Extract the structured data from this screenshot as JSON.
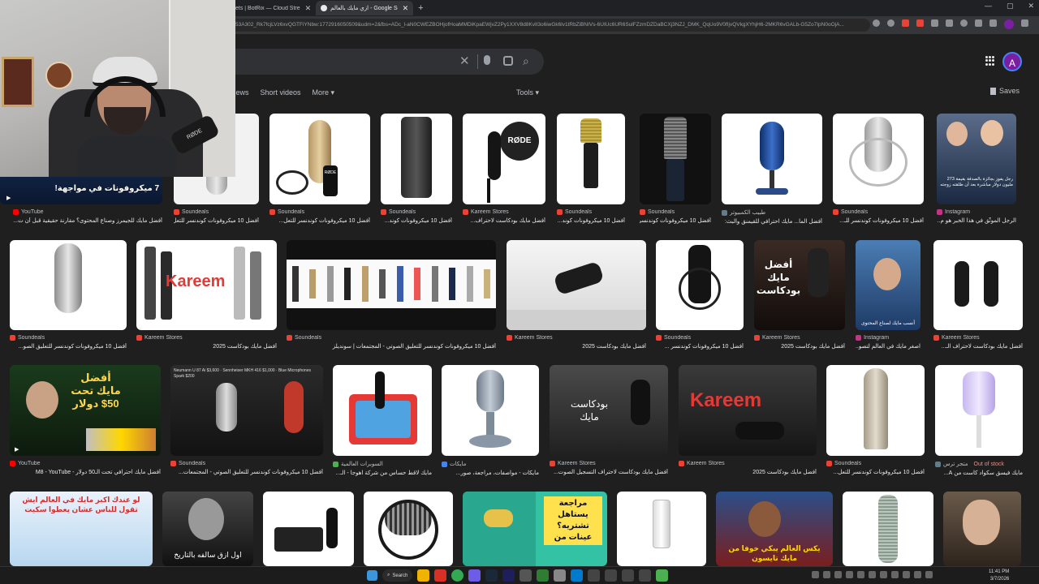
{
  "browser": {
    "tabs": [
      {
        "label": "ets | BotRix — Cloud Stre",
        "active": false
      },
      {
        "label": "ازي مايك بالعالم - Google Search",
        "active": true
      }
    ],
    "url": "53A302_Rk7fcjLVz6xvQGTFiYNbw:1772916050509&udm=2&fbs=ADc_l-aN0CWEZBOHjofHoaMMDiKpaEWjvZ2Py1XXV8d8KvlI3o6iwGk6lv1tRbZiBNIVs-6UIUc6UR6SulFZzmDZDaBCXj3NZJ_DMK_QqUo9V0fIjvQVkgXYhjH6-2MKR6vGALb-G5Zo7IpN0oOjA..."
  },
  "search": {
    "clear_label": "✕",
    "filters": [
      "News",
      "Short videos",
      "More ▾"
    ],
    "tools_label": "Tools ▾",
    "saves_label": "Saves",
    "profile_initial": "A"
  },
  "results": [
    {
      "source": "YouTube",
      "caption": "أفضل مايك للجيمرز وصناع المحتوى؟ مقارنة حقيقية قبل أن ت...",
      "src_color": "#ff0000",
      "overlay_text": "7 ميكروفونات في مواجهة!"
    },
    {
      "source": "Soundeals",
      "caption": "أفضل 10 ميكروفونات كوندنسر للتعل...",
      "src_color": "#ea4335"
    },
    {
      "source": "Soundeals",
      "caption": "أفضل 10 ميكروفونات كوندنسر للتعل...",
      "src_color": "#ea4335",
      "logo": "RØDE"
    },
    {
      "source": "Soundeals",
      "caption": "أفضل 10 ميكروفونات كوند...",
      "src_color": "#ea4335"
    },
    {
      "source": "Kareem Stores",
      "caption": "أفضل مايك بودكاست لاحتراف...",
      "src_color": "#ea4335",
      "logo": "RØDE"
    },
    {
      "source": "Soundeals",
      "caption": "أفضل 10 ميكروفونات كوند...",
      "src_color": "#ea4335"
    },
    {
      "source": "Soundeals",
      "caption": "أفضل 10 ميكروفونات كوندنسر...",
      "src_color": "#ea4335"
    },
    {
      "source": "طبيب الكمبيوتر",
      "caption": "أفضل الما... مايك احترافي للقيمنق والبث:",
      "src_color": "#607d8b"
    },
    {
      "source": "Soundeals",
      "caption": "أفضل 10 ميكروفونات كوندنسر للـ...",
      "src_color": "#ea4335"
    },
    {
      "source": "Instagram",
      "caption": "الرجل الموثّق في هذا الخبر هو م...",
      "src_color": "#c13584",
      "overlay_text": "رجل يفوز بجائزة بالصدفة بقيمة 273 مليون دولار مباشرة بعد أن طلقته زوجته"
    },
    {
      "source": "Soundeals",
      "caption": "أفضل 10 ميكروفونات كوندنسر للتعليق الصو...",
      "src_color": "#ea4335"
    },
    {
      "source": "Kareem Stores",
      "caption": "أفضل مايك بودكاست 2025",
      "src_color": "#ea4335",
      "logo": "Kareem"
    },
    {
      "source": "Soundeals",
      "caption": "أفضل 10 ميكروفونات كوندنسر للتعليق الصوتي - المجتمعات | سونديلز",
      "src_color": "#ea4335"
    },
    {
      "source": "Kareem Stores",
      "caption": "أفضل مايك بودكاست 2025",
      "src_color": "#ea4335"
    },
    {
      "source": "Soundeals",
      "caption": "أفضل 10 ميكروفونات كوندنسر ...",
      "src_color": "#ea4335"
    },
    {
      "source": "Kareem Stores",
      "caption": "أفضل مايك بودكاست 2025",
      "src_color": "#ea4335",
      "overlay_text": "أفضل مايك بودكاست"
    },
    {
      "source": "Instagram",
      "caption": "اصغر مايك في العالم لتصو...",
      "src_color": "#c13584",
      "overlay_text": "أنسب مايك لصناع المحتوى"
    },
    {
      "source": "Kareem Stores",
      "caption": "أفضل مايك بودكاست لاحتراف الـ...",
      "src_color": "#ea4335"
    },
    {
      "source": "YouTube",
      "caption": "أفضل مايك احترافي تحت الـ50 دولار - M8 - YouTube",
      "src_color": "#ff0000",
      "overlay_text": "أفضل مايك تحت 50$ دولار"
    },
    {
      "source": "Soundeals",
      "caption": "أفضل 10 ميكروفونات كوندنسر للتعليق الصوتي - المجتمعات...",
      "src_color": "#ea4335",
      "overlay_text": "Neumann U 87 Ai $3,600 · Sennheiser MKH 416 $1,000 · Blue Microphones Spark $200"
    },
    {
      "source": "السوبرات العالمية",
      "caption": "مايك لاقط حساس من شركة اهوجا - الـ...",
      "src_color": "#4caf50"
    },
    {
      "source": "مايكات",
      "caption": "مايكات - مواصفات، مراجعة، صور...",
      "src_color": "#4285f4"
    },
    {
      "source": "Kareem Stores",
      "caption": "أفضل مايك بودكاست لاحتراف التسجيل الصوت...",
      "src_color": "#ea4335",
      "overlay_text": "بودكاست مايك"
    },
    {
      "source": "Kareem Stores",
      "caption": "أفضل مايك بودكاست 2025",
      "src_color": "#ea4335",
      "logo": "Kareem"
    },
    {
      "source": "Soundeals",
      "caption": "أفضل 10 ميكروفونات كوندنسر للتعل...",
      "src_color": "#ea4335"
    },
    {
      "source": "متجر ترس",
      "caption": "مايك فيسق سكواد كاست من A...",
      "src_color": "#607d8b",
      "extra": "Out of stock"
    },
    {
      "overlay_text": "لو عندك اكبر مايك في العالم ايش تقول للناس عشان يعطوا سكيت"
    },
    {
      "overlay_text": "اول ازق سالفه بالتاريخ"
    },
    {},
    {},
    {
      "overlay_text": "مراجعة يستاهل تشتريه؟ عينات من"
    },
    {},
    {
      "overlay_text": "يكس العالم يبكي خوفا من مايك تايسون"
    },
    {},
    {}
  ],
  "taskbar": {
    "search_label": "Search",
    "time": "11:41 PM",
    "date": "3/7/2026"
  }
}
